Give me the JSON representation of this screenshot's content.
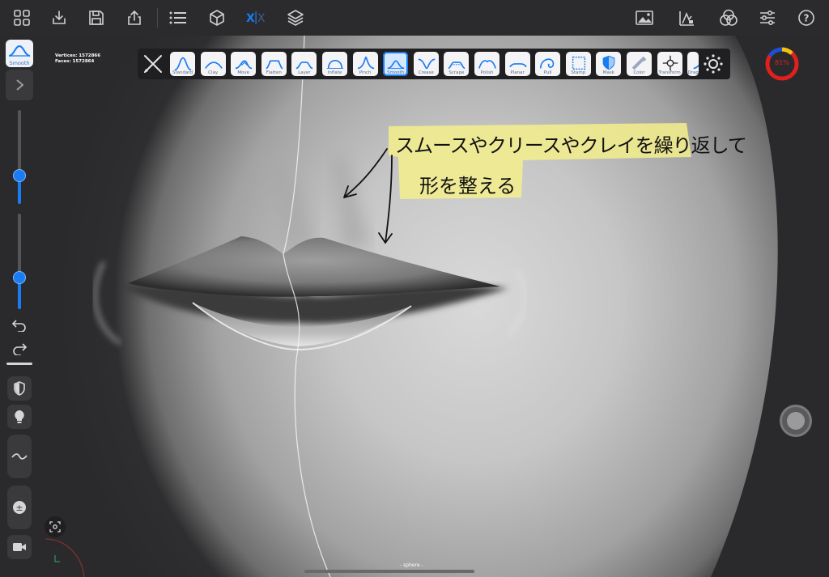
{
  "stats": {
    "vertices_label": "Vertices: 1572866",
    "faces_label": "Faces:   1572864"
  },
  "active_tool_thumb": {
    "label": "Smooth"
  },
  "tools": [
    {
      "label": "Standard"
    },
    {
      "label": "Clay"
    },
    {
      "label": "Move"
    },
    {
      "label": "Flatten"
    },
    {
      "label": "Layer"
    },
    {
      "label": "Inflate"
    },
    {
      "label": "Pinch"
    },
    {
      "label": "Smooth"
    },
    {
      "label": "Crease"
    },
    {
      "label": "Scrape"
    },
    {
      "label": "Polish"
    },
    {
      "label": "Planar"
    },
    {
      "label": "Pull"
    },
    {
      "label": "Stamp"
    },
    {
      "label": "Mask"
    },
    {
      "label": "Color"
    },
    {
      "label": "Transform"
    },
    {
      "label": "Drag"
    }
  ],
  "annotation": {
    "line1": "スムースやクリースやクレイを繰り返して",
    "line2": "形を整える",
    "highlight_color": "#f3ef8c"
  },
  "memory_gauge": {
    "label": "81%",
    "value": 0.81
  },
  "object_name": "- sphere -",
  "colors": {
    "accent": "#1a7cf2",
    "gauge_red": "#e0201c"
  },
  "sliders": {
    "radius": 0.45,
    "intensity": 0.4
  }
}
